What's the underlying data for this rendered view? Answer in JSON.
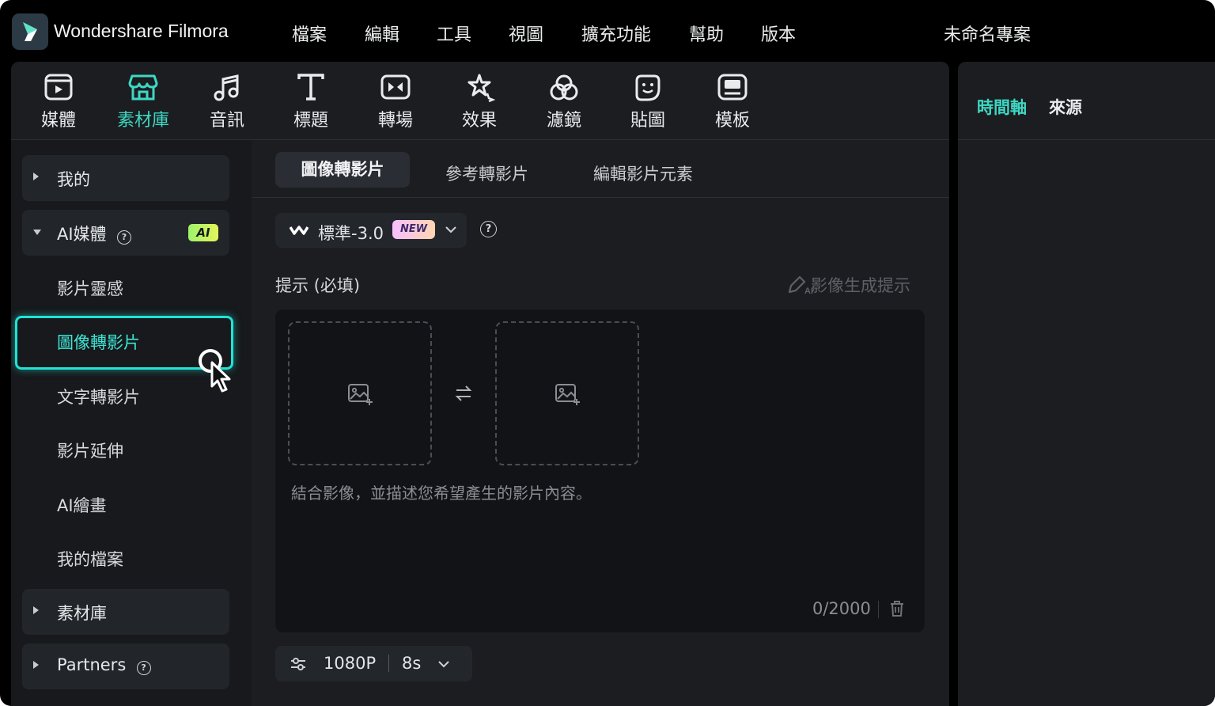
{
  "app": {
    "title": "Wondershare Filmora",
    "project_title": "未命名專案"
  },
  "menu": [
    "檔案",
    "編輯",
    "工具",
    "視圖",
    "擴充功能",
    "幫助",
    "版本"
  ],
  "toolbar": {
    "items": [
      {
        "label": "媒體",
        "icon": "media-icon",
        "active": false
      },
      {
        "label": "素材庫",
        "icon": "stock-library-icon",
        "active": true
      },
      {
        "label": "音訊",
        "icon": "music-note-icon",
        "active": false
      },
      {
        "label": "標題",
        "icon": "title-text-icon",
        "active": false
      },
      {
        "label": "轉場",
        "icon": "transition-icon",
        "active": false
      },
      {
        "label": "效果",
        "icon": "effects-sparkle-icon",
        "active": false
      },
      {
        "label": "濾鏡",
        "icon": "filter-icon",
        "active": false
      },
      {
        "label": "貼圖",
        "icon": "sticker-icon",
        "active": false
      },
      {
        "label": "模板",
        "icon": "template-icon",
        "active": false
      }
    ]
  },
  "right_panel": {
    "tabs": [
      "時間軸",
      "來源"
    ],
    "active_tab": "時間軸"
  },
  "sidebar": {
    "groups": [
      {
        "label": "我的",
        "expanded": false
      },
      {
        "label": "AI媒體",
        "expanded": true,
        "badge": "AI"
      },
      {
        "label": "素材庫",
        "expanded": false
      },
      {
        "label": "Partners",
        "expanded": false
      }
    ],
    "ai_items": [
      "影片靈感",
      "圖像轉影片",
      "文字轉影片",
      "影片延伸",
      "AI繪畫",
      "我的檔案"
    ],
    "selected": "圖像轉影片"
  },
  "content": {
    "tabs": [
      "圖像轉影片",
      "參考轉影片",
      "編輯影片元素"
    ],
    "active_tab": "圖像轉影片",
    "model": {
      "name": "標準-3.0",
      "badge": "NEW"
    },
    "prompt_label": "提示 (必填)",
    "prompt_hint": "影像生成提示",
    "prompt_placeholder": "結合影像，並描述您希望產生的影片內容。",
    "char_count": "0/2000",
    "settings": {
      "resolution": "1080P",
      "duration": "8s"
    }
  },
  "colors": {
    "accent": "#3ed8c3",
    "highlight": "#20e3d6",
    "panel": "#1b1d21",
    "background": "#000000"
  }
}
